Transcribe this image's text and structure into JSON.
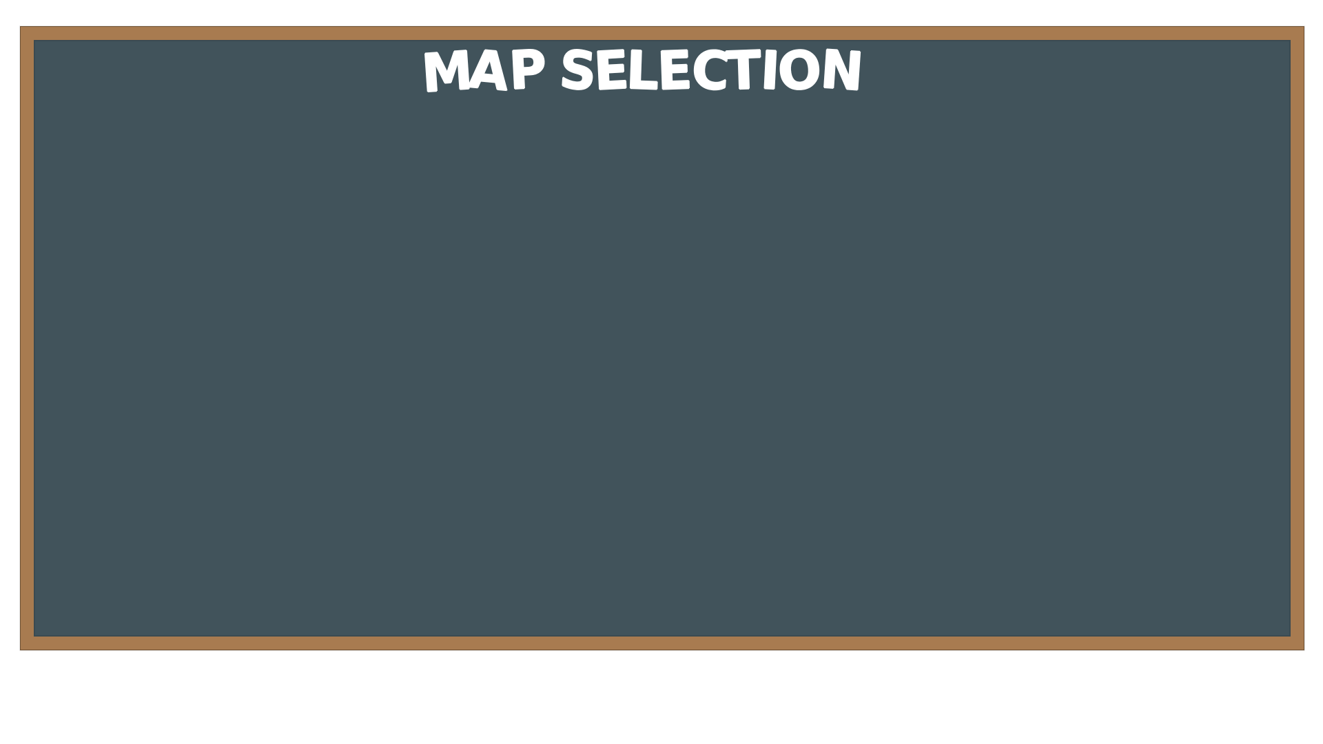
{
  "screen": {
    "title": "MAP SELECTION"
  },
  "colors": {
    "frame": "#a87b50",
    "board": "#41535b",
    "title": "#ffffff",
    "background": "#ffffff"
  }
}
